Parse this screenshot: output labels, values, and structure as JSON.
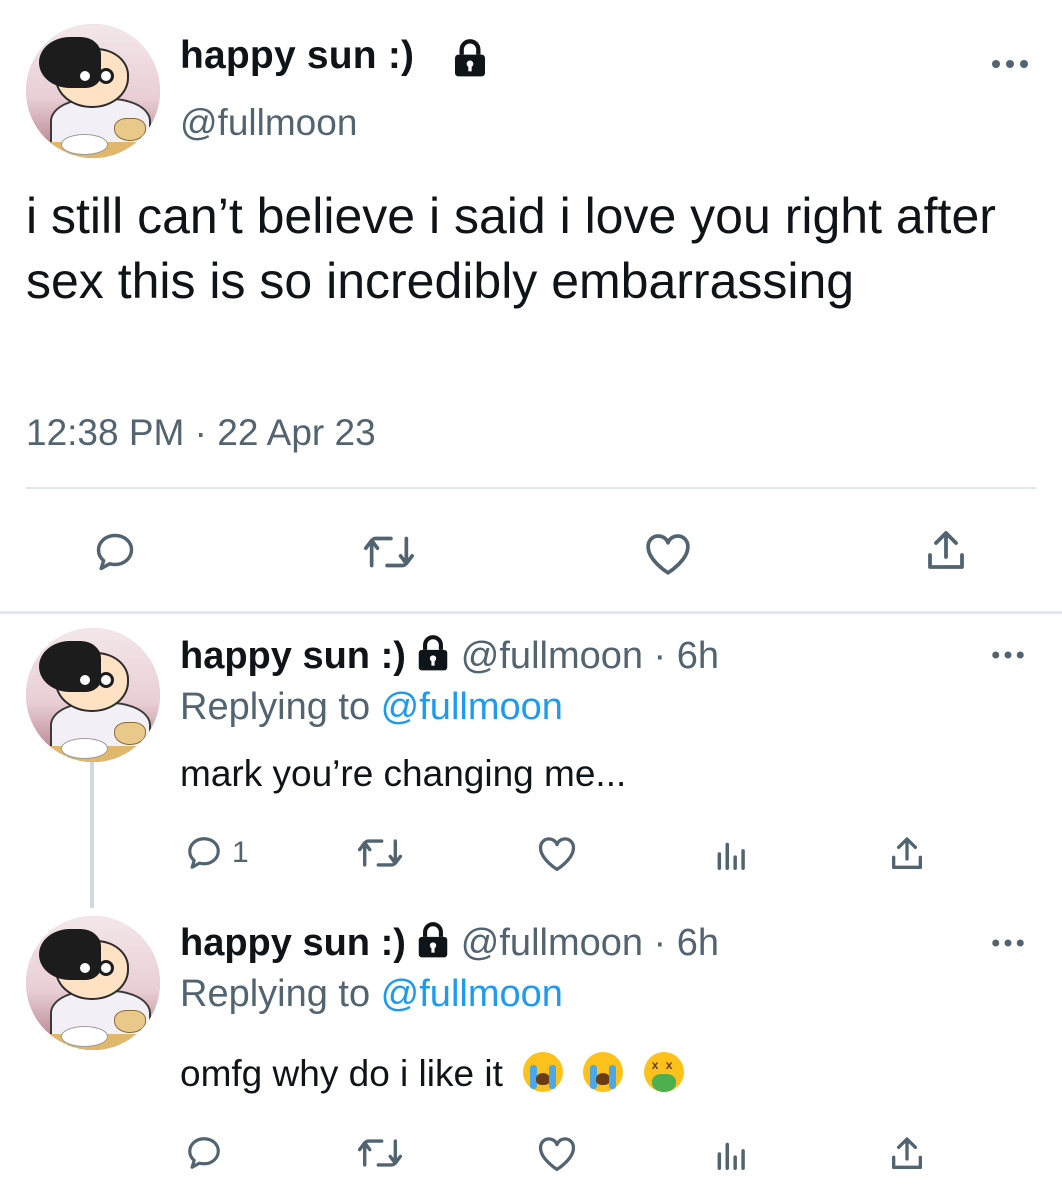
{
  "main_tweet": {
    "display_name": "happy sun :)",
    "handle": "@fullmoon",
    "text": "i still can’t believe i said i love you right after sex this is so incredibly embarrassing",
    "timestamp": "12:38 PM · 22 Apr 23",
    "icons": {
      "lock": "lock-icon",
      "more": "more-icon",
      "reply": "reply-icon",
      "retweet": "retweet-icon",
      "like": "like-icon",
      "share": "share-icon"
    }
  },
  "replies": [
    {
      "display_name": "happy sun :)",
      "handle_time": "@fullmoon · 6h",
      "replying_prefix": "Replying to ",
      "replying_to": "@fullmoon",
      "text": "mark you’re changing me...",
      "reply_count": "1",
      "emojis": []
    },
    {
      "display_name": "happy sun :)",
      "handle_time": "@fullmoon · 6h",
      "replying_prefix": "Replying to ",
      "replying_to": "@fullmoon",
      "text": "omfg why do i like it",
      "reply_count": "",
      "emojis": [
        "loudly-crying-face",
        "loudly-crying-face",
        "nauseated-face"
      ]
    }
  ],
  "colors": {
    "text": "#0f1419",
    "secondary": "#536471",
    "link": "#1d9bf0",
    "divider": "#e1e8ed"
  }
}
